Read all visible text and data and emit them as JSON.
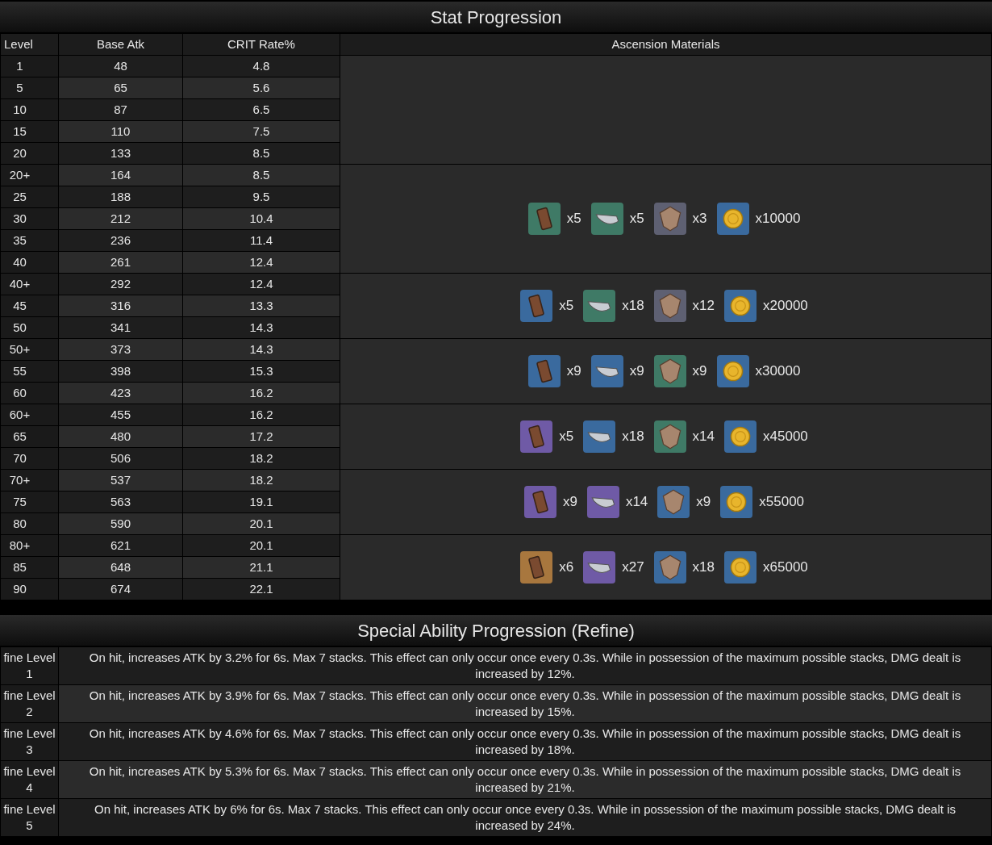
{
  "stat_progression": {
    "title": "Stat Progression",
    "columns": [
      "Level",
      "Base Atk",
      "CRIT Rate%",
      "Ascension Materials"
    ],
    "groups": [
      {
        "rows": [
          {
            "level": "1",
            "base_atk": "48",
            "crit_rate": "4.8"
          },
          {
            "level": "5",
            "base_atk": "65",
            "crit_rate": "5.6"
          },
          {
            "level": "10",
            "base_atk": "87",
            "crit_rate": "6.5"
          },
          {
            "level": "15",
            "base_atk": "110",
            "crit_rate": "7.5"
          },
          {
            "level": "20",
            "base_atk": "133",
            "crit_rate": "8.5"
          }
        ]
      },
      {
        "rows": [
          {
            "level": "20+",
            "base_atk": "164",
            "crit_rate": "8.5"
          },
          {
            "level": "25",
            "base_atk": "188",
            "crit_rate": "9.5"
          },
          {
            "level": "30",
            "base_atk": "212",
            "crit_rate": "10.4"
          },
          {
            "level": "35",
            "base_atk": "236",
            "crit_rate": "11.4"
          },
          {
            "level": "40",
            "base_atk": "261",
            "crit_rate": "12.4"
          }
        ],
        "materials": [
          {
            "kind": "plate",
            "color": "#3f7a66",
            "count": "x5"
          },
          {
            "kind": "blade",
            "color": "#3f7a66",
            "count": "x5"
          },
          {
            "kind": "emblem",
            "color": "#5e6072",
            "count": "x3"
          },
          {
            "kind": "coin",
            "color": "#3a6a9e",
            "count": "x10000"
          }
        ]
      },
      {
        "rows": [
          {
            "level": "40+",
            "base_atk": "292",
            "crit_rate": "12.4"
          },
          {
            "level": "45",
            "base_atk": "316",
            "crit_rate": "13.3"
          },
          {
            "level": "50",
            "base_atk": "341",
            "crit_rate": "14.3"
          }
        ],
        "materials": [
          {
            "kind": "plate",
            "color": "#3a6a9e",
            "count": "x5"
          },
          {
            "kind": "blade",
            "color": "#3f7a66",
            "count": "x18"
          },
          {
            "kind": "emblem",
            "color": "#5e6072",
            "count": "x12"
          },
          {
            "kind": "coin",
            "color": "#3a6a9e",
            "count": "x20000"
          }
        ]
      },
      {
        "rows": [
          {
            "level": "50+",
            "base_atk": "373",
            "crit_rate": "14.3"
          },
          {
            "level": "55",
            "base_atk": "398",
            "crit_rate": "15.3"
          },
          {
            "level": "60",
            "base_atk": "423",
            "crit_rate": "16.2"
          }
        ],
        "materials": [
          {
            "kind": "plate",
            "color": "#3a6a9e",
            "count": "x9"
          },
          {
            "kind": "blade",
            "color": "#3a6a9e",
            "count": "x9"
          },
          {
            "kind": "emblem",
            "color": "#3f7a66",
            "count": "x9"
          },
          {
            "kind": "coin",
            "color": "#3a6a9e",
            "count": "x30000"
          }
        ]
      },
      {
        "rows": [
          {
            "level": "60+",
            "base_atk": "455",
            "crit_rate": "16.2"
          },
          {
            "level": "65",
            "base_atk": "480",
            "crit_rate": "17.2"
          },
          {
            "level": "70",
            "base_atk": "506",
            "crit_rate": "18.2"
          }
        ],
        "materials": [
          {
            "kind": "plate",
            "color": "#6f5aa6",
            "count": "x5"
          },
          {
            "kind": "blade",
            "color": "#3a6a9e",
            "count": "x18"
          },
          {
            "kind": "emblem",
            "color": "#3f7a66",
            "count": "x14"
          },
          {
            "kind": "coin",
            "color": "#3a6a9e",
            "count": "x45000"
          }
        ]
      },
      {
        "rows": [
          {
            "level": "70+",
            "base_atk": "537",
            "crit_rate": "18.2"
          },
          {
            "level": "75",
            "base_atk": "563",
            "crit_rate": "19.1"
          },
          {
            "level": "80",
            "base_atk": "590",
            "crit_rate": "20.1"
          }
        ],
        "materials": [
          {
            "kind": "plate",
            "color": "#6f5aa6",
            "count": "x9"
          },
          {
            "kind": "blade",
            "color": "#6f5aa6",
            "count": "x14"
          },
          {
            "kind": "emblem",
            "color": "#3a6a9e",
            "count": "x9"
          },
          {
            "kind": "coin",
            "color": "#3a6a9e",
            "count": "x55000"
          }
        ]
      },
      {
        "rows": [
          {
            "level": "80+",
            "base_atk": "621",
            "crit_rate": "20.1"
          },
          {
            "level": "85",
            "base_atk": "648",
            "crit_rate": "21.1"
          },
          {
            "level": "90",
            "base_atk": "674",
            "crit_rate": "22.1"
          }
        ],
        "materials": [
          {
            "kind": "plate",
            "color": "#a8773e",
            "count": "x6"
          },
          {
            "kind": "blade",
            "color": "#6f5aa6",
            "count": "x27"
          },
          {
            "kind": "emblem",
            "color": "#3a6a9e",
            "count": "x18"
          },
          {
            "kind": "coin",
            "color": "#3a6a9e",
            "count": "x65000"
          }
        ]
      }
    ]
  },
  "refine_progression": {
    "title": "Special Ability Progression (Refine)",
    "rows": [
      {
        "level": "fine Level 1",
        "effect": "On hit, increases ATK by 3.2% for 6s. Max 7 stacks. This effect can only occur once every 0.3s. While in possession of the maximum possible stacks, DMG dealt is increased by 12%."
      },
      {
        "level": "fine Level 2",
        "effect": "On hit, increases ATK by 3.9% for 6s. Max 7 stacks. This effect can only occur once every 0.3s. While in possession of the maximum possible stacks, DMG dealt is increased by 15%."
      },
      {
        "level": "fine Level 3",
        "effect": "On hit, increases ATK by 4.6% for 6s. Max 7 stacks. This effect can only occur once every 0.3s. While in possession of the maximum possible stacks, DMG dealt is increased by 18%."
      },
      {
        "level": "fine Level 4",
        "effect": "On hit, increases ATK by 5.3% for 6s. Max 7 stacks. This effect can only occur once every 0.3s. While in possession of the maximum possible stacks, DMG dealt is increased by 21%."
      },
      {
        "level": "fine Level 5",
        "effect": "On hit, increases ATK by 6% for 6s. Max 7 stacks. This effect can only occur once every 0.3s. While in possession of the maximum possible stacks, DMG dealt is increased by 24%."
      }
    ]
  }
}
